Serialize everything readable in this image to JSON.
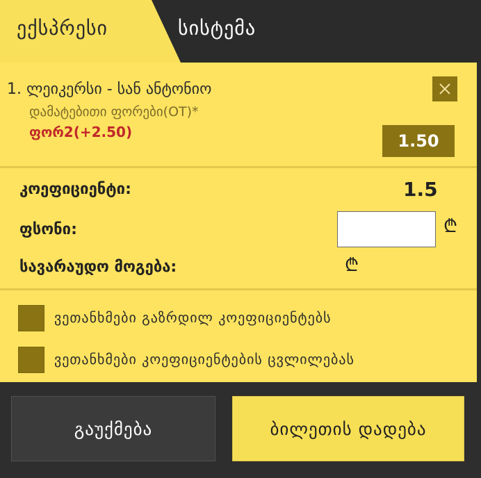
{
  "tabs": {
    "express": "ექსპრესი",
    "system": "სისტემა"
  },
  "bet": {
    "title": "1. ლეიკერსი - სან ანტონიო",
    "market": "დამატებითი ფორები(OT)*",
    "pick": "ფორ2(+2.50)",
    "odd": "1.50",
    "close_icon": "close-icon"
  },
  "summary": {
    "coef_label": "კოეფიციენტი:",
    "coef_value": "1.5",
    "stake_label": "ფსონი:",
    "stake_value": "",
    "currency_symbol": "₾",
    "potential_label": "სავარაუდო მოგება:"
  },
  "options": {
    "accept_increased": "ვეთანხმები გაზრდილ კოეფიციენტებს",
    "accept_changes": "ვეთანხმები კოეფიციენტების ცვლილებას"
  },
  "buttons": {
    "cancel": "გაუქმება",
    "place": "ბილეთის დადება"
  },
  "colors": {
    "accent_yellow": "#fde35f",
    "dark": "#2e2e2e",
    "olive": "#8a7313",
    "pick_red": "#c0282a"
  }
}
